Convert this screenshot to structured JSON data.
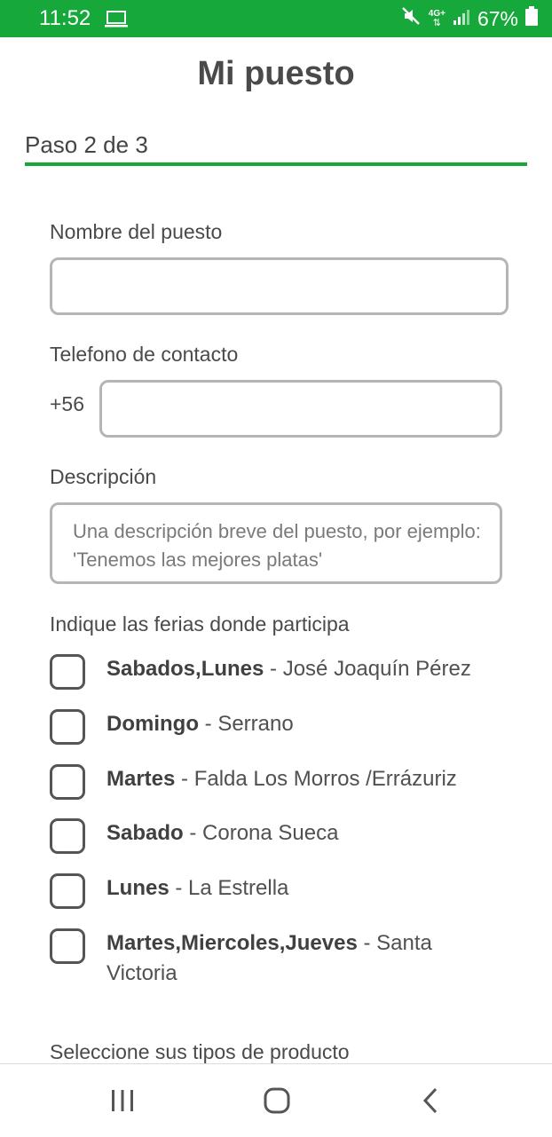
{
  "status_bar": {
    "time": "11:52",
    "battery": "67%",
    "network": "4G+"
  },
  "header": {
    "title": "Mi puesto"
  },
  "step": {
    "label": "Paso 2 de 3"
  },
  "form": {
    "name_label": "Nombre del puesto",
    "name_value": "",
    "phone_label": "Telefono de contacto",
    "phone_prefix": "+56",
    "phone_value": "",
    "description_label": "Descripción",
    "description_placeholder": "Una descripción breve del puesto, por ejemplo: 'Tenemos las mejores platas'",
    "fairs_label": "Indique las ferias donde participa",
    "fairs": [
      {
        "days": "Sabados,Lunes",
        "place": "José Joaquín Pérez",
        "checked": false
      },
      {
        "days": "Domingo",
        "place": "Serrano",
        "checked": false
      },
      {
        "days": "Martes",
        "place": "Falda Los Morros /Errázuriz",
        "checked": false
      },
      {
        "days": "Sabado",
        "place": "Corona Sueca",
        "checked": false
      },
      {
        "days": "Lunes",
        "place": "La Estrella",
        "checked": false
      },
      {
        "days": "Martes,Miercoles,Jueves",
        "place": "Santa Victoria",
        "checked": false
      }
    ],
    "separator": " - ",
    "product_types_label": "Seleccione sus tipos de producto"
  },
  "colors": {
    "accent": "#16a83a",
    "border": "#b5b5b5",
    "text": "#4a4a4a"
  },
  "nav": {
    "icons": [
      "recent-apps-icon",
      "home-icon",
      "back-icon"
    ]
  }
}
